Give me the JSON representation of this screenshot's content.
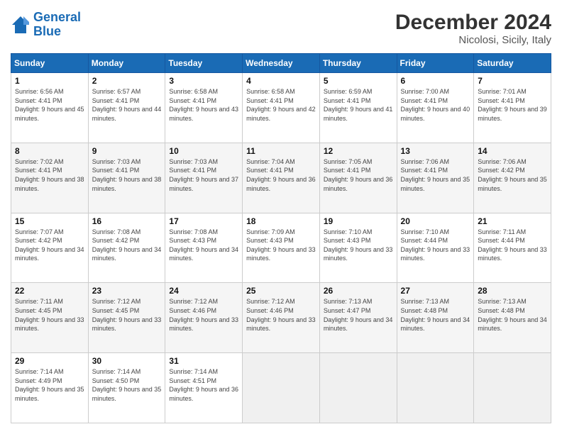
{
  "header": {
    "logo_line1": "General",
    "logo_line2": "Blue",
    "title": "December 2024",
    "subtitle": "Nicolosi, Sicily, Italy"
  },
  "days_of_week": [
    "Sunday",
    "Monday",
    "Tuesday",
    "Wednesday",
    "Thursday",
    "Friday",
    "Saturday"
  ],
  "weeks": [
    [
      {
        "day": "1",
        "sunrise": "6:56 AM",
        "sunset": "4:41 PM",
        "daylight": "9 hours and 45 minutes."
      },
      {
        "day": "2",
        "sunrise": "6:57 AM",
        "sunset": "4:41 PM",
        "daylight": "9 hours and 44 minutes."
      },
      {
        "day": "3",
        "sunrise": "6:58 AM",
        "sunset": "4:41 PM",
        "daylight": "9 hours and 43 minutes."
      },
      {
        "day": "4",
        "sunrise": "6:58 AM",
        "sunset": "4:41 PM",
        "daylight": "9 hours and 42 minutes."
      },
      {
        "day": "5",
        "sunrise": "6:59 AM",
        "sunset": "4:41 PM",
        "daylight": "9 hours and 41 minutes."
      },
      {
        "day": "6",
        "sunrise": "7:00 AM",
        "sunset": "4:41 PM",
        "daylight": "9 hours and 40 minutes."
      },
      {
        "day": "7",
        "sunrise": "7:01 AM",
        "sunset": "4:41 PM",
        "daylight": "9 hours and 39 minutes."
      }
    ],
    [
      {
        "day": "8",
        "sunrise": "7:02 AM",
        "sunset": "4:41 PM",
        "daylight": "9 hours and 38 minutes."
      },
      {
        "day": "9",
        "sunrise": "7:03 AM",
        "sunset": "4:41 PM",
        "daylight": "9 hours and 38 minutes."
      },
      {
        "day": "10",
        "sunrise": "7:03 AM",
        "sunset": "4:41 PM",
        "daylight": "9 hours and 37 minutes."
      },
      {
        "day": "11",
        "sunrise": "7:04 AM",
        "sunset": "4:41 PM",
        "daylight": "9 hours and 36 minutes."
      },
      {
        "day": "12",
        "sunrise": "7:05 AM",
        "sunset": "4:41 PM",
        "daylight": "9 hours and 36 minutes."
      },
      {
        "day": "13",
        "sunrise": "7:06 AM",
        "sunset": "4:41 PM",
        "daylight": "9 hours and 35 minutes."
      },
      {
        "day": "14",
        "sunrise": "7:06 AM",
        "sunset": "4:42 PM",
        "daylight": "9 hours and 35 minutes."
      }
    ],
    [
      {
        "day": "15",
        "sunrise": "7:07 AM",
        "sunset": "4:42 PM",
        "daylight": "9 hours and 34 minutes."
      },
      {
        "day": "16",
        "sunrise": "7:08 AM",
        "sunset": "4:42 PM",
        "daylight": "9 hours and 34 minutes."
      },
      {
        "day": "17",
        "sunrise": "7:08 AM",
        "sunset": "4:43 PM",
        "daylight": "9 hours and 34 minutes."
      },
      {
        "day": "18",
        "sunrise": "7:09 AM",
        "sunset": "4:43 PM",
        "daylight": "9 hours and 33 minutes."
      },
      {
        "day": "19",
        "sunrise": "7:10 AM",
        "sunset": "4:43 PM",
        "daylight": "9 hours and 33 minutes."
      },
      {
        "day": "20",
        "sunrise": "7:10 AM",
        "sunset": "4:44 PM",
        "daylight": "9 hours and 33 minutes."
      },
      {
        "day": "21",
        "sunrise": "7:11 AM",
        "sunset": "4:44 PM",
        "daylight": "9 hours and 33 minutes."
      }
    ],
    [
      {
        "day": "22",
        "sunrise": "7:11 AM",
        "sunset": "4:45 PM",
        "daylight": "9 hours and 33 minutes."
      },
      {
        "day": "23",
        "sunrise": "7:12 AM",
        "sunset": "4:45 PM",
        "daylight": "9 hours and 33 minutes."
      },
      {
        "day": "24",
        "sunrise": "7:12 AM",
        "sunset": "4:46 PM",
        "daylight": "9 hours and 33 minutes."
      },
      {
        "day": "25",
        "sunrise": "7:12 AM",
        "sunset": "4:46 PM",
        "daylight": "9 hours and 33 minutes."
      },
      {
        "day": "26",
        "sunrise": "7:13 AM",
        "sunset": "4:47 PM",
        "daylight": "9 hours and 34 minutes."
      },
      {
        "day": "27",
        "sunrise": "7:13 AM",
        "sunset": "4:48 PM",
        "daylight": "9 hours and 34 minutes."
      },
      {
        "day": "28",
        "sunrise": "7:13 AM",
        "sunset": "4:48 PM",
        "daylight": "9 hours and 34 minutes."
      }
    ],
    [
      {
        "day": "29",
        "sunrise": "7:14 AM",
        "sunset": "4:49 PM",
        "daylight": "9 hours and 35 minutes."
      },
      {
        "day": "30",
        "sunrise": "7:14 AM",
        "sunset": "4:50 PM",
        "daylight": "9 hours and 35 minutes."
      },
      {
        "day": "31",
        "sunrise": "7:14 AM",
        "sunset": "4:51 PM",
        "daylight": "9 hours and 36 minutes."
      },
      null,
      null,
      null,
      null
    ]
  ]
}
